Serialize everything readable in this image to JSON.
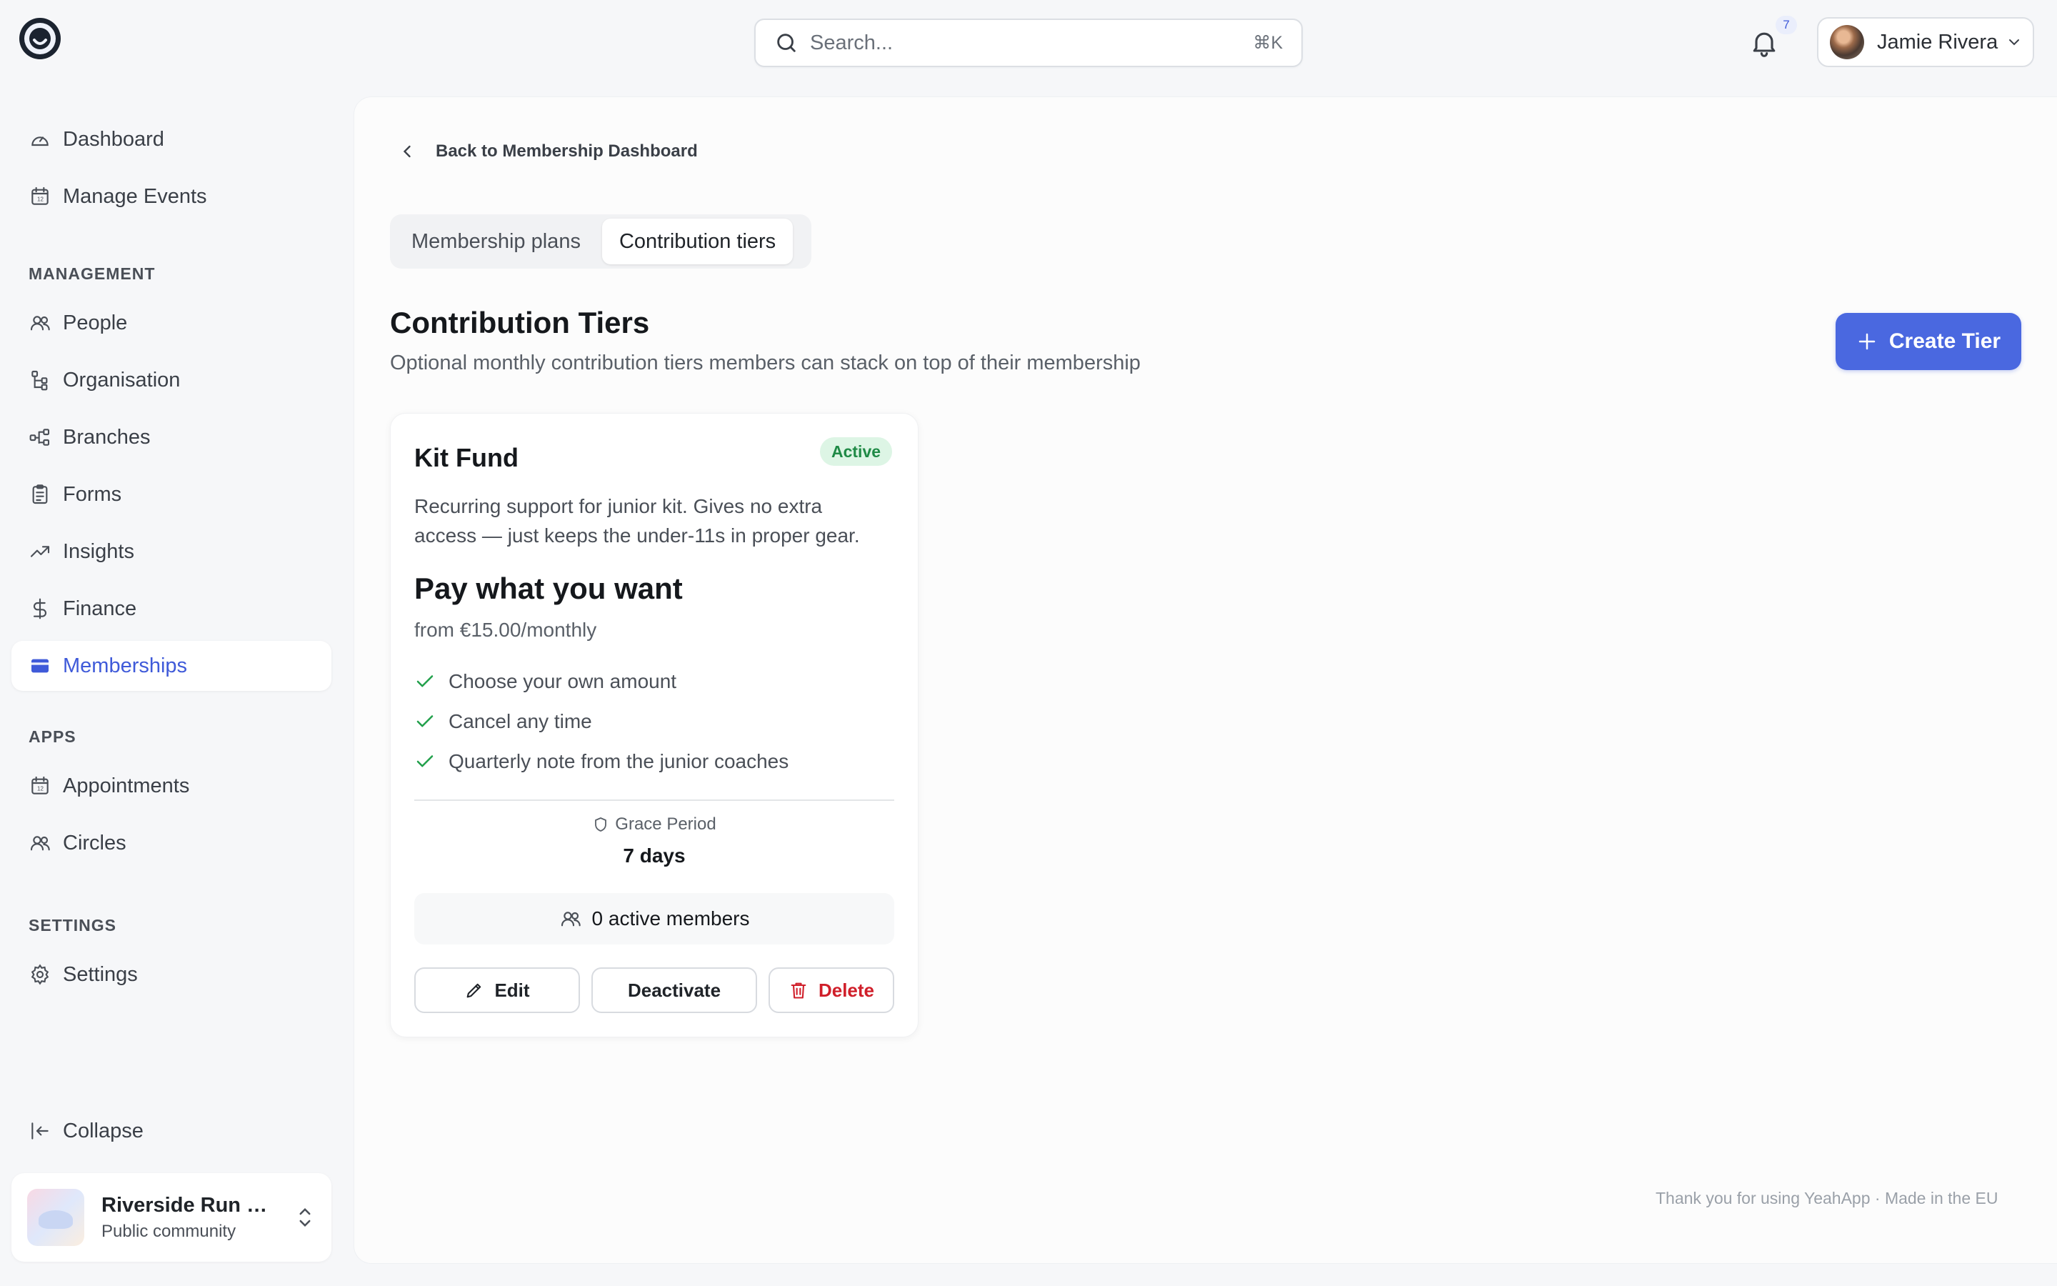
{
  "topbar": {
    "search_placeholder": "Search...",
    "search_shortcut": "⌘K",
    "notification_count": "7",
    "user_name": "Jamie Rivera"
  },
  "sidebar": {
    "primary": [
      {
        "label": "Dashboard",
        "icon": "gauge-icon"
      },
      {
        "label": "Manage Events",
        "icon": "calendar-icon"
      }
    ],
    "management_label": "MANAGEMENT",
    "management": [
      {
        "label": "People",
        "icon": "people-icon"
      },
      {
        "label": "Organisation",
        "icon": "org-tree-icon"
      },
      {
        "label": "Branches",
        "icon": "branches-icon"
      },
      {
        "label": "Forms",
        "icon": "clipboard-icon"
      },
      {
        "label": "Insights",
        "icon": "trending-up-icon"
      },
      {
        "label": "Finance",
        "icon": "dollar-icon"
      },
      {
        "label": "Memberships",
        "icon": "card-icon",
        "active": true
      }
    ],
    "apps_label": "APPS",
    "apps": [
      {
        "label": "Appointments",
        "icon": "calendar-icon"
      },
      {
        "label": "Circles",
        "icon": "people-icon"
      }
    ],
    "settings_label": "SETTINGS",
    "settings": [
      {
        "label": "Settings",
        "icon": "gear-icon"
      }
    ],
    "collapse_label": "Collapse",
    "org": {
      "name": "Riverside Run Cl...",
      "subtitle": "Public community"
    }
  },
  "main": {
    "back_label": "Back to Membership Dashboard",
    "tabs": [
      {
        "label": "Membership plans",
        "active": false
      },
      {
        "label": "Contribution tiers",
        "active": true
      }
    ],
    "title": "Contribution Tiers",
    "subtitle": "Optional monthly contribution tiers members can stack on top of their membership",
    "create_label": "Create Tier",
    "accent_color": "#4a68e0",
    "tier": {
      "name": "Kit Fund",
      "status": "Active",
      "description": "Recurring support for junior kit. Gives no extra access — just keeps the under-11s in proper gear.",
      "price_title": "Pay what you want",
      "price_sub": "from €15.00/monthly",
      "features": [
        "Choose your own amount",
        "Cancel any time",
        "Quarterly note from the junior coaches"
      ],
      "grace_label": "Grace Period",
      "grace_value": "7 days",
      "members": "0 active members",
      "edit_label": "Edit",
      "deactivate_label": "Deactivate",
      "delete_label": "Delete"
    },
    "footer": "Thank you for using YeahApp · Made in the EU"
  }
}
